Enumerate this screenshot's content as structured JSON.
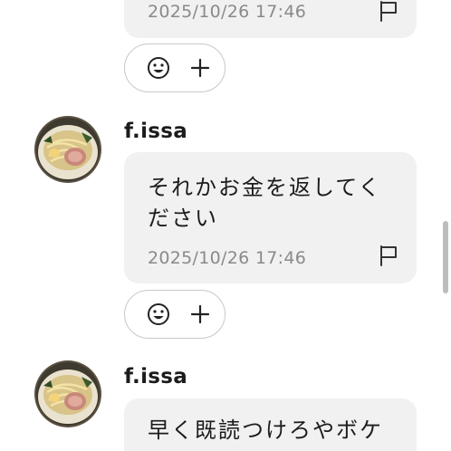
{
  "messages": [
    {
      "timestamp": "2025/10/26 17:46"
    },
    {
      "username": "f.issa",
      "text_line1": "それかお金を返してく",
      "text_line2": "ださい",
      "timestamp": "2025/10/26 17:46"
    },
    {
      "username": "f.issa",
      "text_line1": "早く既読つけろやボケ"
    }
  ],
  "icons": {
    "avatar": "noodle-bowl-avatar",
    "flag": "flag-icon",
    "reaction": "smile-icon",
    "add": "plus-icon"
  },
  "colors": {
    "bubble_bg": "#f1f1f2",
    "text": "#1c1c1c",
    "timestamp": "#8a8a8a",
    "pill_border": "#c8c8c8"
  }
}
